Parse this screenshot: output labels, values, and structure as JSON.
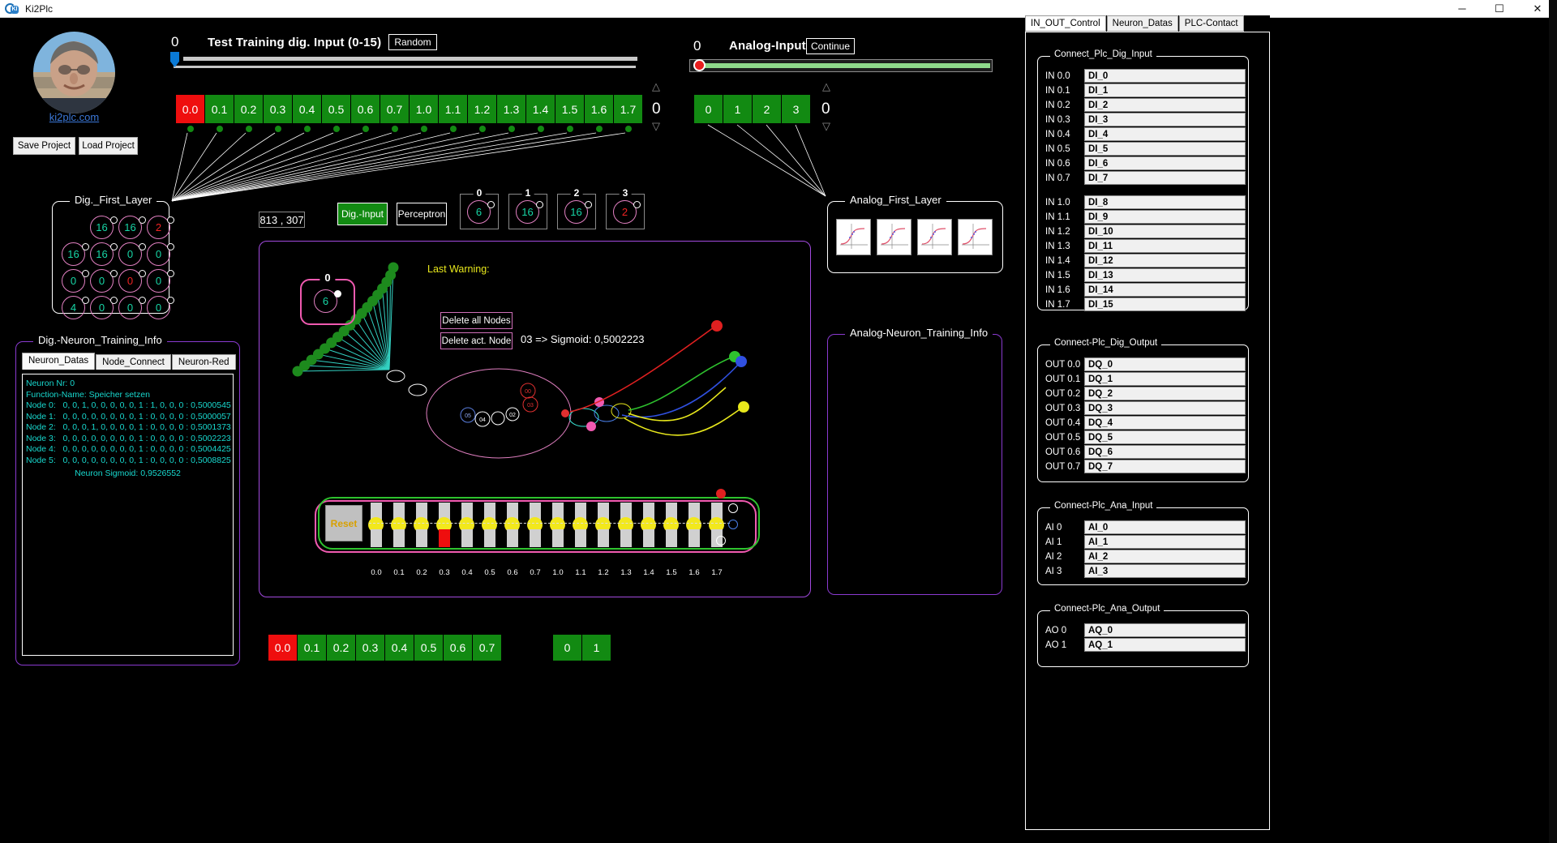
{
  "window": {
    "title": "Ki2Plc",
    "app_icon": "ki2plc-logo-icon",
    "minimize": "─",
    "maximize": "☐",
    "close": "✕"
  },
  "profile": {
    "avatar": "user-photo",
    "link_text": "ki2plc.com",
    "save_project": "Save Project",
    "load_project": "Load Project"
  },
  "dig_input": {
    "value": "0",
    "title": "Test Training dig. Input (0-15)",
    "random_button": "Random",
    "spin_value": "0",
    "bits": [
      {
        "label": "0.0",
        "state": "red"
      },
      {
        "label": "0.1",
        "state": "green"
      },
      {
        "label": "0.2",
        "state": "green"
      },
      {
        "label": "0.3",
        "state": "green"
      },
      {
        "label": "0.4",
        "state": "green"
      },
      {
        "label": "0.5",
        "state": "green"
      },
      {
        "label": "0.6",
        "state": "green"
      },
      {
        "label": "0.7",
        "state": "green"
      },
      {
        "label": "1.0",
        "state": "green"
      },
      {
        "label": "1.1",
        "state": "green"
      },
      {
        "label": "1.2",
        "state": "green"
      },
      {
        "label": "1.3",
        "state": "green"
      },
      {
        "label": "1.4",
        "state": "green"
      },
      {
        "label": "1.5",
        "state": "green"
      },
      {
        "label": "1.6",
        "state": "green"
      },
      {
        "label": "1.7",
        "state": "green"
      }
    ]
  },
  "analog_input": {
    "value": "0",
    "title": "Analog-Input",
    "continue_button": "Continue",
    "spin_value": "0",
    "bits": [
      "0",
      "1",
      "2",
      "3"
    ]
  },
  "dig_first_layer": {
    "caption": "Dig._First_Layer",
    "nodes": [
      [
        null,
        {
          "v": "16",
          "color": "teal"
        },
        {
          "v": "16",
          "color": "teal"
        },
        {
          "v": "2",
          "color": "red"
        }
      ],
      [
        {
          "v": "16",
          "color": "teal"
        },
        {
          "v": "16",
          "color": "teal"
        },
        {
          "v": "0",
          "color": "teal"
        },
        {
          "v": "0",
          "color": "teal"
        }
      ],
      [
        {
          "v": "0",
          "color": "teal"
        },
        {
          "v": "0",
          "color": "teal"
        },
        {
          "v": "0",
          "color": "red"
        },
        {
          "v": "0",
          "color": "teal"
        }
      ],
      [
        {
          "v": "4",
          "color": "teal"
        },
        {
          "v": "0",
          "color": "teal"
        },
        {
          "v": "0",
          "color": "teal"
        },
        {
          "v": "0",
          "color": "teal"
        }
      ]
    ]
  },
  "analog_first_layer": {
    "caption": "Analog_First_Layer",
    "thumbnails": [
      "sigmoid-plot-0",
      "sigmoid-plot-1",
      "sigmoid-plot-2",
      "sigmoid-plot-3"
    ]
  },
  "dig_training_info": {
    "caption": "Dig.-Neuron_Training_Info",
    "tabs": [
      "Neuron_Datas",
      "Node_Connect",
      "Neuron-Red"
    ],
    "active_tab": "Neuron_Datas",
    "lines": [
      "Neuron Nr: 0",
      "Function-Name: Speicher setzen",
      "Node 0:   0, 0, 1, 0, 0, 0, 0, 0, 1 : 1, 0, 0, 0 : 0,5000545",
      "Node 1:   0, 0, 0, 0, 0, 0, 0, 0, 1 : 0, 0, 0, 0 : 0,5000057",
      "Node 2:   0, 0, 0, 1, 0, 0, 0, 0, 1 : 0, 0, 0, 0 : 0,5001373",
      "Node 3:   0, 0, 0, 0, 0, 0, 0, 0, 1 : 0, 0, 0, 0 : 0,5002223",
      "Node 4:   0, 0, 0, 0, 0, 0, 0, 0, 1 : 0, 0, 0, 0 : 0,5004425",
      "Node 5:   0, 0, 0, 0, 0, 0, 0, 0, 1 : 0, 0, 0, 0 : 0,5008825"
    ],
    "footer": "Neuron Sigmoid: 0,9526552"
  },
  "analog_training_info": {
    "caption": "Analog-Neuron_Training_Info",
    "lines": []
  },
  "center": {
    "coords": "813 , 307",
    "dig_input_button": "Dig.-Input",
    "perceptron_button": "Perceptron",
    "last_warning_label": "Last Warning:",
    "last_warning_value": "",
    "delete_all_nodes": "Delete all Nodes",
    "delete_act_node": "Delete act. Node",
    "sigmoid_text": "03   => Sigmoid: 0,5002223",
    "selected_node_caption": "0",
    "selected_node_value": "6",
    "reset_button": "Reset",
    "strip_labels": [
      "0.0",
      "0.1",
      "0.2",
      "0.3",
      "0.4",
      "0.5",
      "0.6",
      "0.7",
      "1.0",
      "1.1",
      "1.2",
      "1.3",
      "1.4",
      "1.5",
      "1.6",
      "1.7"
    ]
  },
  "node_boxes": [
    {
      "caption": "0",
      "value": "6",
      "color": "teal"
    },
    {
      "caption": "1",
      "value": "16",
      "color": "teal"
    },
    {
      "caption": "2",
      "value": "16",
      "color": "teal"
    },
    {
      "caption": "3",
      "value": "2",
      "color": "red"
    }
  ],
  "plc": {
    "tabs": [
      "IN_OUT_Control",
      "Neuron_Datas",
      "PLC-Contact"
    ],
    "active_tab": "IN_OUT_Control",
    "dig_input": {
      "caption": "Connect_Plc_Dig_Input",
      "rows": [
        {
          "addr": "IN 0.0",
          "name": "DI_0"
        },
        {
          "addr": "IN 0.1",
          "name": "DI_1"
        },
        {
          "addr": "IN 0.2",
          "name": "DI_2"
        },
        {
          "addr": "IN 0.3",
          "name": "DI_3"
        },
        {
          "addr": "IN 0.4",
          "name": "DI_4"
        },
        {
          "addr": "IN 0.5",
          "name": "DI_5"
        },
        {
          "addr": "IN 0.6",
          "name": "DI_6"
        },
        {
          "addr": "IN 0.7",
          "name": "DI_7"
        },
        {
          "addr": "IN 1.0",
          "name": "DI_8"
        },
        {
          "addr": "IN 1.1",
          "name": "DI_9"
        },
        {
          "addr": "IN 1.2",
          "name": "DI_10"
        },
        {
          "addr": "IN 1.3",
          "name": "DI_11"
        },
        {
          "addr": "IN 1.4",
          "name": "DI_12"
        },
        {
          "addr": "IN 1.5",
          "name": "DI_13"
        },
        {
          "addr": "IN 1.6",
          "name": "DI_14"
        },
        {
          "addr": "IN 1.7",
          "name": "DI_15"
        }
      ]
    },
    "dig_output": {
      "caption": "Connect-Plc_Dig_Output",
      "rows": [
        {
          "addr": "OUT 0.0",
          "name": "DQ_0"
        },
        {
          "addr": "OUT 0.1",
          "name": "DQ_1"
        },
        {
          "addr": "OUT 0.2",
          "name": "DQ_2"
        },
        {
          "addr": "OUT 0.3",
          "name": "DQ_3"
        },
        {
          "addr": "OUT 0.4",
          "name": "DQ_4"
        },
        {
          "addr": "OUT 0.5",
          "name": "DQ_5"
        },
        {
          "addr": "OUT 0.6",
          "name": "DQ_6"
        },
        {
          "addr": "OUT 0.7",
          "name": "DQ_7"
        }
      ]
    },
    "ana_input": {
      "caption": "Connect-Plc_Ana_Input",
      "rows": [
        {
          "addr": "AI 0",
          "name": "AI_0"
        },
        {
          "addr": "AI 1",
          "name": "AI_1"
        },
        {
          "addr": "AI 2",
          "name": "AI_2"
        },
        {
          "addr": "AI 3",
          "name": "AI_3"
        }
      ]
    },
    "ana_output": {
      "caption": "Connect-Plc_Ana_Output",
      "rows": [
        {
          "addr": "AO 0",
          "name": "AQ_0"
        },
        {
          "addr": "AO 1",
          "name": "AQ_1"
        }
      ]
    }
  },
  "bottom": {
    "dig_bits": [
      {
        "label": "0.0",
        "state": "red"
      },
      {
        "label": "0.1",
        "state": "green"
      },
      {
        "label": "0.2",
        "state": "green"
      },
      {
        "label": "0.3",
        "state": "green"
      },
      {
        "label": "0.4",
        "state": "green"
      },
      {
        "label": "0.5",
        "state": "green"
      },
      {
        "label": "0.6",
        "state": "green"
      },
      {
        "label": "0.7",
        "state": "green"
      }
    ],
    "ana_bits": [
      "0",
      "1"
    ]
  },
  "colors": {
    "green": "#128a12",
    "red": "#ef0e0e",
    "pink": "#cf6fb8",
    "purple": "#8a3ad0",
    "teal": "#17d6a6",
    "yellow": "#e8e81c",
    "link": "#3b78d8"
  }
}
